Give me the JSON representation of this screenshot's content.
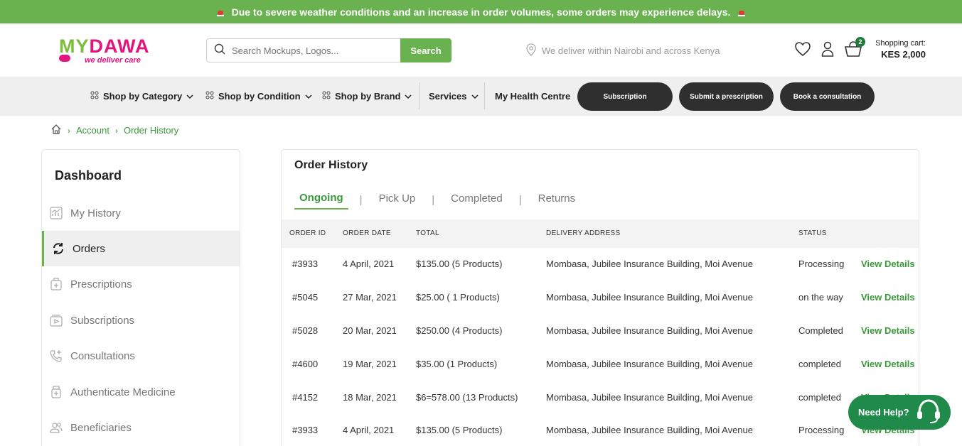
{
  "banner": {
    "text": "Due to severe weather conditions and an increase in order volumes, some orders may experience delays.",
    "icon": "alarm-icon"
  },
  "logo": {
    "my": "MY",
    "dawa": "DAWA",
    "tagline": "we deliver care"
  },
  "search": {
    "placeholder": "Search Mockups, Logos...",
    "button": "Search"
  },
  "delivery": {
    "text": "We deliver within Nairobi and across Kenya"
  },
  "cart": {
    "count": "2",
    "label": "Shopping cart:",
    "amount": "KES 2,000"
  },
  "nav": {
    "items": [
      "Shop by Category",
      "Shop by Condition",
      "Shop by Brand",
      "Services",
      "My Health Centre"
    ],
    "pills": [
      "Subscription",
      "Submit a prescription",
      "Book a consultation"
    ]
  },
  "breadcrumb": [
    "Account",
    "Order History"
  ],
  "sidebar": {
    "title": "Dashboard",
    "items": [
      {
        "label": "My History",
        "icon": "chart-icon"
      },
      {
        "label": "Orders",
        "icon": "refresh-icon"
      },
      {
        "label": "Prescriptions",
        "icon": "medkit-icon"
      },
      {
        "label": "Subscriptions",
        "icon": "play-icon"
      },
      {
        "label": "Consultations",
        "icon": "phone-plus-icon"
      },
      {
        "label": "Authenticate Medicine",
        "icon": "medicine-icon"
      },
      {
        "label": "Beneficiaries",
        "icon": "users-icon"
      }
    ]
  },
  "orders": {
    "title": "Order History",
    "tabs": [
      "Ongoing",
      "Pick Up",
      "Completed",
      "Returns"
    ],
    "columns": [
      "ORDER ID",
      "ORDER DATE",
      "TOTAL",
      "DELIVERY ADDRESS",
      "STATUS"
    ],
    "action": "View Details",
    "rows": [
      {
        "id": "#3933",
        "date": "4 April, 2021",
        "total": "$135.00 (5 Products)",
        "address": "Mombasa, Jubilee Insurance Building, Moi Avenue",
        "status": "Processing"
      },
      {
        "id": "#5045",
        "date": "27 Mar, 2021",
        "total": "$25.00 ( 1 Products)",
        "address": "Mombasa, Jubilee Insurance Building, Moi Avenue",
        "status": "on the way"
      },
      {
        "id": "#5028",
        "date": "20 Mar, 2021",
        "total": "$250.00 (4 Products)",
        "address": "Mombasa, Jubilee Insurance Building, Moi Avenue",
        "status": "Completed"
      },
      {
        "id": "#4600",
        "date": "19 Mar, 2021",
        "total": "$35.00 (1 Products)",
        "address": "Mombasa, Jubilee Insurance Building, Moi Avenue",
        "status": "completed"
      },
      {
        "id": "#4152",
        "date": "18 Mar, 2021",
        "total": "$6=578.00 (13 Products)",
        "address": "Mombasa, Jubilee Insurance Building, Moi Avenue",
        "status": "completed"
      },
      {
        "id": "#3933",
        "date": "4 April, 2021",
        "total": "$135.00 (5 Products)",
        "address": "Mombasa, Jubilee Insurance Building, Moi Avenue",
        "status": "Processing"
      }
    ]
  },
  "help": {
    "label": "Need Help?"
  },
  "colors": {
    "brand_green": "#6ab150",
    "dark_green": "#1f8a4a",
    "brand_pink": "#e0157e",
    "pill_dark": "#2f2f2f"
  }
}
